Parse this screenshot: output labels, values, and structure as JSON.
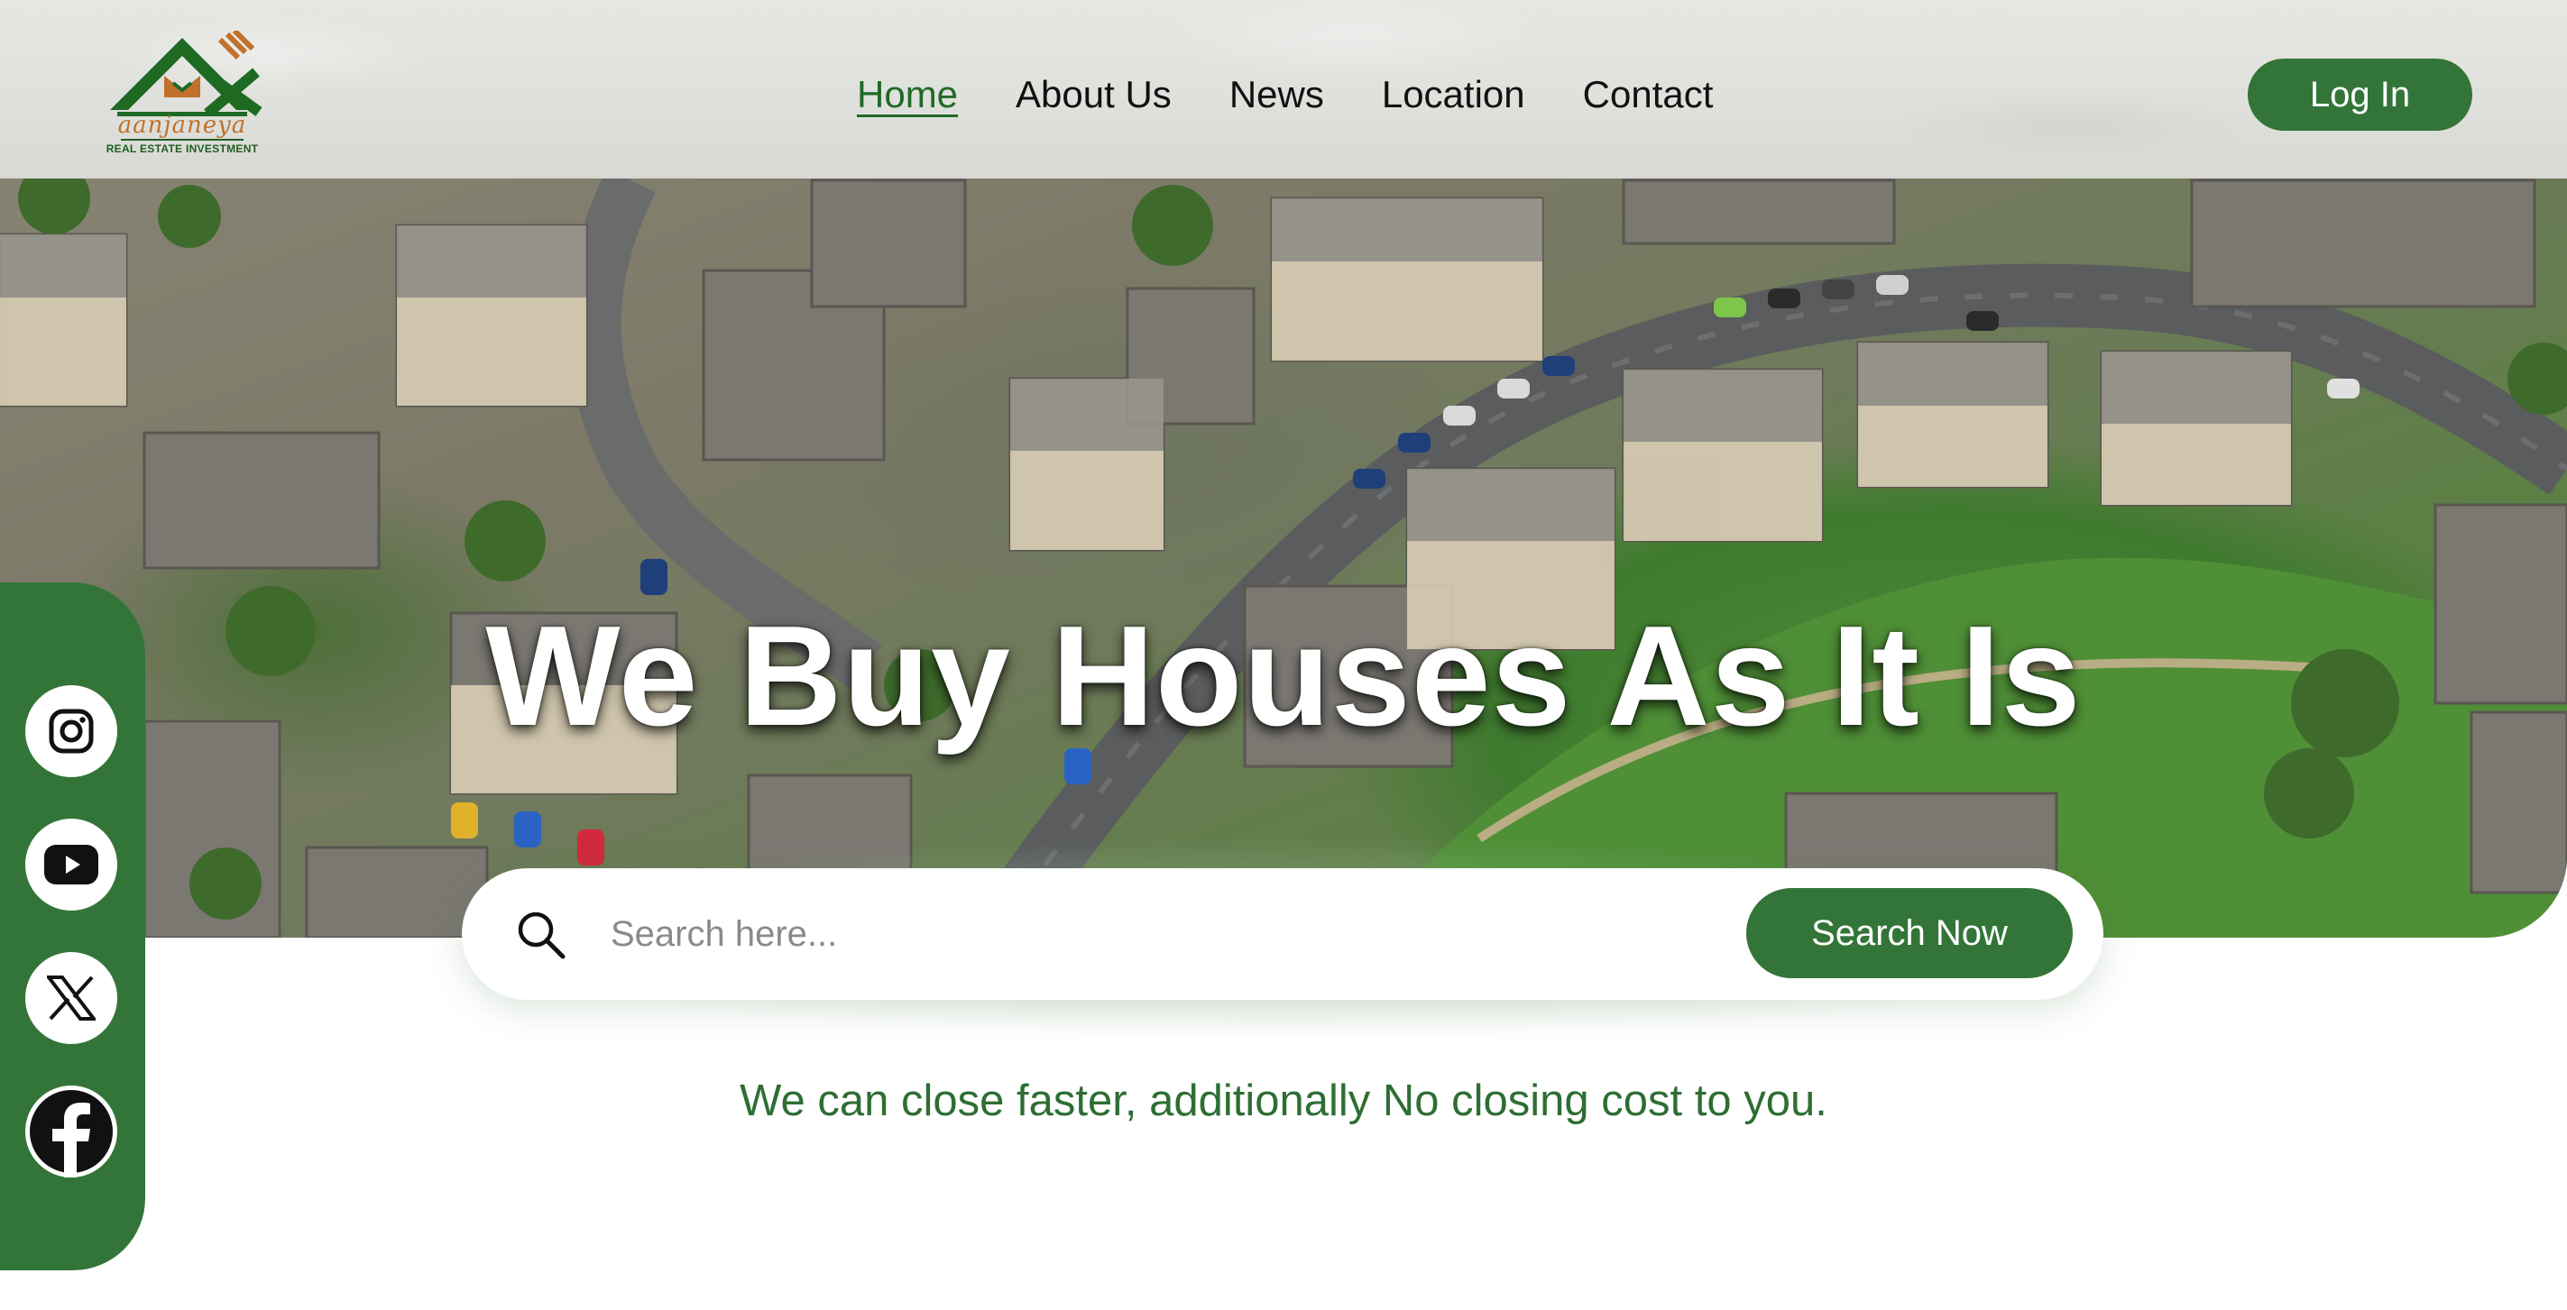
{
  "brand": {
    "logo_name": "aanjaneya",
    "logo_tagline": "REAL ESTATE INVESTMENT",
    "primary_color": "#337538",
    "accent_color": "#c0712b"
  },
  "nav": {
    "items": [
      {
        "label": "Home",
        "active": true
      },
      {
        "label": "About Us",
        "active": false
      },
      {
        "label": "News",
        "active": false
      },
      {
        "label": "Location",
        "active": false
      },
      {
        "label": "Contact",
        "active": false
      }
    ],
    "login_label": "Log In"
  },
  "hero": {
    "headline": "We Buy Houses As It Is"
  },
  "search": {
    "placeholder": "Search here...",
    "value": "",
    "button_label": "Search Now",
    "icon": "search-icon"
  },
  "tagline": "We can close faster, additionally No closing cost to you.",
  "social": [
    {
      "name": "instagram",
      "icon": "instagram-icon"
    },
    {
      "name": "youtube",
      "icon": "youtube-icon"
    },
    {
      "name": "x",
      "icon": "x-icon"
    },
    {
      "name": "facebook",
      "icon": "facebook-icon"
    }
  ]
}
